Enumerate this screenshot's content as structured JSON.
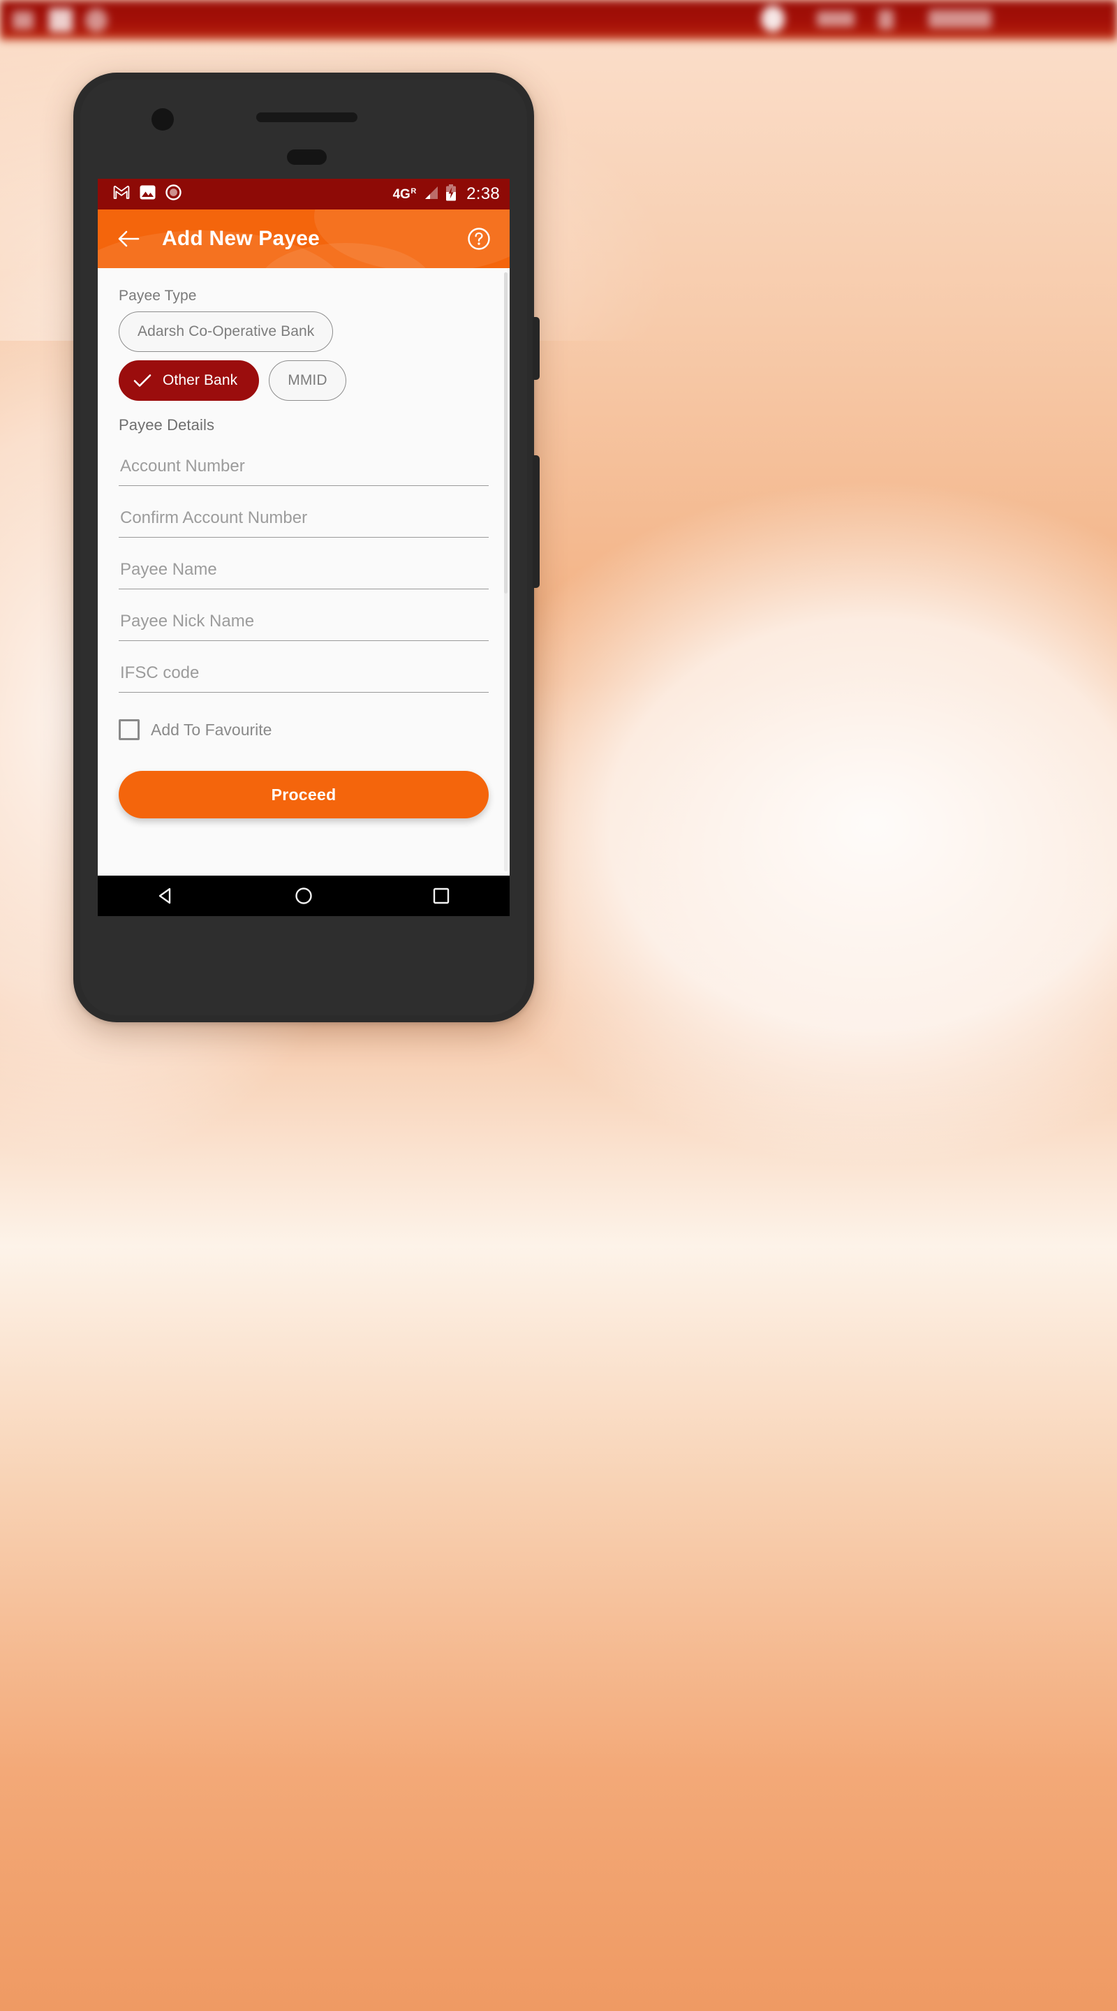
{
  "desktop": {
    "chrome_bar_color": "#9a0d06",
    "background_accent": "#f4a06a"
  },
  "phone": {
    "statusbar": {
      "background_color": "#8e0a06",
      "left_icons": [
        "gmail-icon",
        "photos-icon",
        "record-icon"
      ],
      "network_label": "4G",
      "network_sup": "R",
      "signal_icon": "signal-bars-icon",
      "battery_icon": "battery-charging-icon",
      "clock": "2:38"
    },
    "appbar": {
      "background_color": "#f4650c",
      "back_icon": "arrow-left-icon",
      "title": "Add New Payee",
      "help_icon": "help-circle-icon"
    },
    "content": {
      "payee_type_label": "Payee Type",
      "payee_type_chips": [
        {
          "label": "Adarsh Co-Operative Bank",
          "selected": false
        },
        {
          "label": "Other Bank",
          "selected": true
        },
        {
          "label": "MMID",
          "selected": false
        }
      ],
      "selected_chip_color": "#9b0d0d",
      "payee_details_label": "Payee Details",
      "fields": [
        {
          "name": "account-number",
          "placeholder": "Account Number",
          "value": ""
        },
        {
          "name": "confirm-account-number",
          "placeholder": "Confirm Account Number",
          "value": ""
        },
        {
          "name": "payee-name",
          "placeholder": "Payee Name",
          "value": ""
        },
        {
          "name": "payee-nick-name",
          "placeholder": "Payee Nick Name",
          "value": ""
        },
        {
          "name": "ifsc-code",
          "placeholder": "IFSC code",
          "value": ""
        }
      ],
      "favourite": {
        "label": "Add To Favourite",
        "checked": false
      },
      "proceed_label": "Proceed",
      "proceed_color": "#f4650c"
    },
    "navbar": {
      "background_color": "#000000",
      "buttons": [
        "back-triangle-icon",
        "home-circle-icon",
        "recents-square-icon"
      ]
    }
  }
}
